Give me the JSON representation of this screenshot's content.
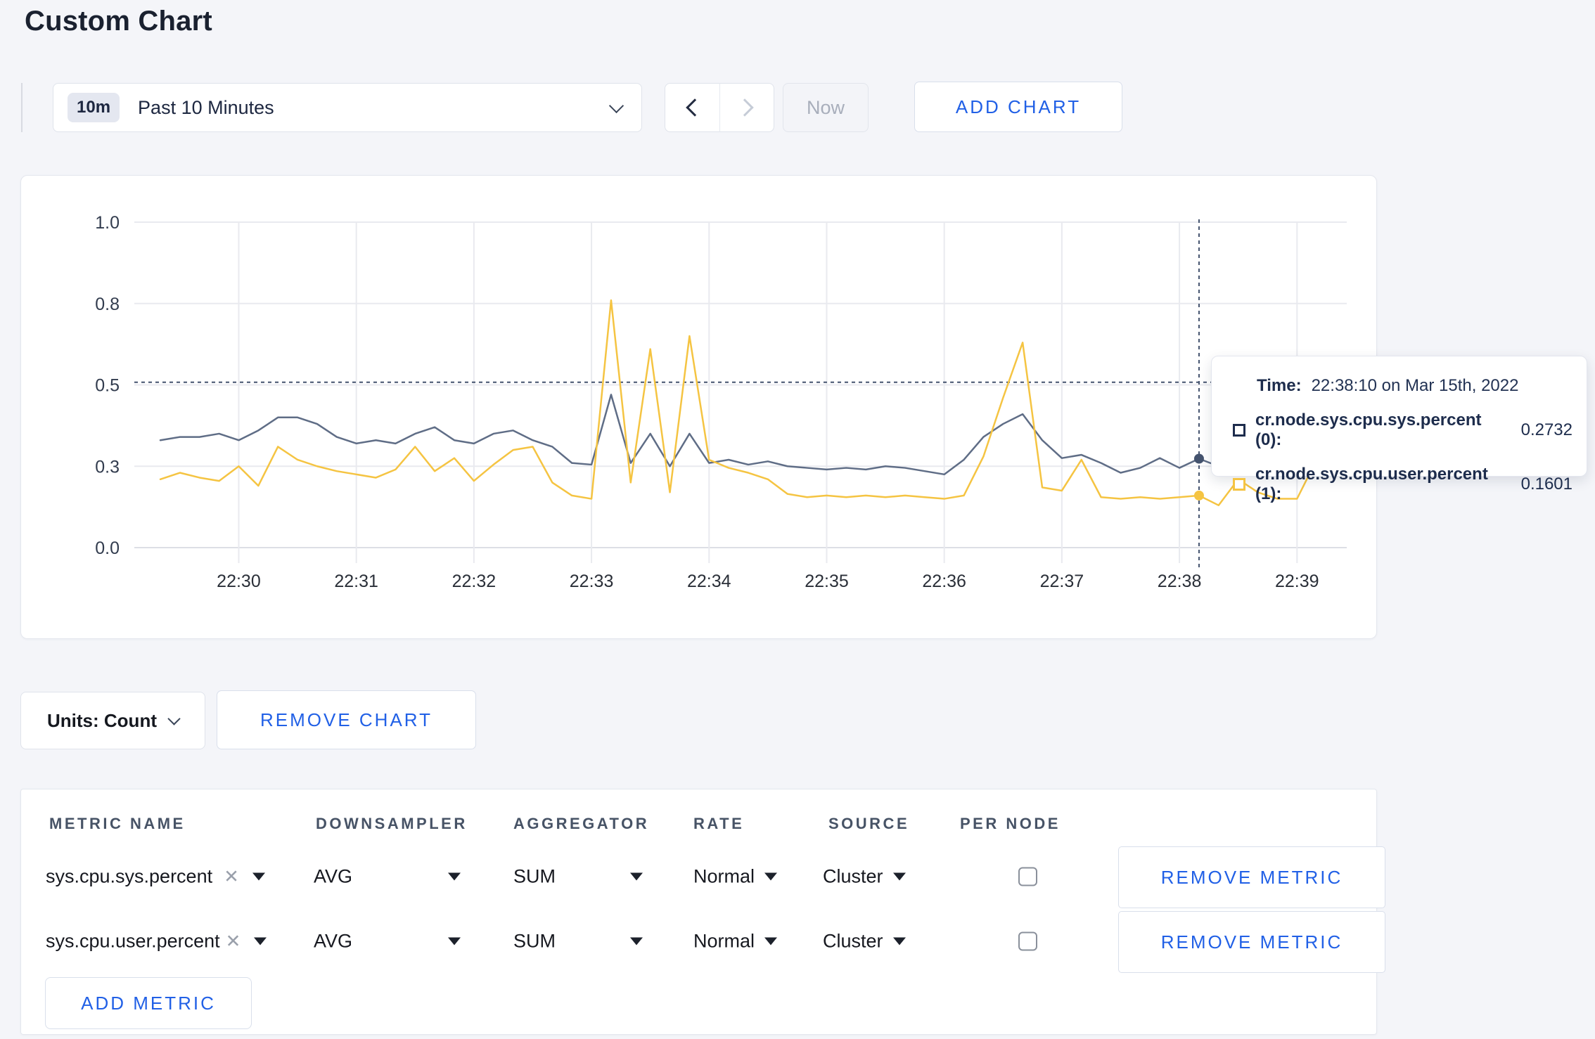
{
  "page": {
    "title": "Custom Chart",
    "background": "#f4f5f9"
  },
  "toolbar": {
    "time_window_badge": "10m",
    "time_window_label": "Past 10 Minutes",
    "now_label": "Now",
    "add_chart_label": "ADD CHART"
  },
  "chart_data": {
    "type": "line",
    "title": "",
    "xlabel": "",
    "ylabel": "",
    "ylim": [
      0,
      1.0
    ],
    "grid": true,
    "legend_position": "none",
    "y_ticks": [
      {
        "value": 0,
        "label": "0.0"
      },
      {
        "value": 0.25,
        "label": "0.3"
      },
      {
        "value": 0.5,
        "label": "0.5"
      },
      {
        "value": 0.75,
        "label": "0.8"
      },
      {
        "value": 1.0,
        "label": "1.0"
      }
    ],
    "x_tick_labels": [
      "22:30",
      "22:31",
      "22:32",
      "22:33",
      "22:34",
      "22:35",
      "22:36",
      "22:37",
      "22:38",
      "22:39"
    ],
    "x": [
      "22:29:20",
      "22:29:30",
      "22:29:40",
      "22:29:50",
      "22:30:00",
      "22:30:10",
      "22:30:20",
      "22:30:30",
      "22:30:40",
      "22:30:50",
      "22:31:00",
      "22:31:10",
      "22:31:20",
      "22:31:30",
      "22:31:40",
      "22:31:50",
      "22:32:00",
      "22:32:10",
      "22:32:20",
      "22:32:30",
      "22:32:40",
      "22:32:50",
      "22:33:00",
      "22:33:10",
      "22:33:20",
      "22:33:30",
      "22:33:40",
      "22:33:50",
      "22:34:00",
      "22:34:10",
      "22:34:20",
      "22:34:30",
      "22:34:40",
      "22:34:50",
      "22:35:00",
      "22:35:10",
      "22:35:20",
      "22:35:30",
      "22:35:40",
      "22:35:50",
      "22:36:00",
      "22:36:10",
      "22:36:20",
      "22:36:30",
      "22:36:40",
      "22:36:50",
      "22:37:00",
      "22:37:10",
      "22:37:20",
      "22:37:30",
      "22:37:40",
      "22:37:50",
      "22:38:00",
      "22:38:10",
      "22:38:20",
      "22:38:30",
      "22:38:40",
      "22:38:50",
      "22:39:00",
      "22:39:10"
    ],
    "series": [
      {
        "name": "cr.node.sys.cpu.sys.percent (0)",
        "color": "#5f6d86",
        "values": [
          0.33,
          0.34,
          0.34,
          0.35,
          0.33,
          0.36,
          0.4,
          0.4,
          0.38,
          0.34,
          0.32,
          0.33,
          0.32,
          0.35,
          0.37,
          0.33,
          0.32,
          0.35,
          0.36,
          0.33,
          0.31,
          0.26,
          0.255,
          0.47,
          0.26,
          0.35,
          0.25,
          0.35,
          0.26,
          0.27,
          0.255,
          0.265,
          0.25,
          0.245,
          0.24,
          0.245,
          0.24,
          0.25,
          0.245,
          0.235,
          0.225,
          0.27,
          0.34,
          0.38,
          0.41,
          0.33,
          0.275,
          0.285,
          0.26,
          0.23,
          0.245,
          0.275,
          0.245,
          0.2732,
          0.25,
          0.24,
          0.27,
          0.275,
          0.28,
          0.3
        ]
      },
      {
        "name": "cr.node.sys.cpu.user.percent (1)",
        "color": "#f5c442",
        "values": [
          0.21,
          0.23,
          0.215,
          0.205,
          0.25,
          0.19,
          0.31,
          0.27,
          0.25,
          0.235,
          0.225,
          0.215,
          0.24,
          0.31,
          0.235,
          0.275,
          0.205,
          0.255,
          0.3,
          0.31,
          0.2,
          0.16,
          0.15,
          0.76,
          0.2,
          0.61,
          0.17,
          0.65,
          0.27,
          0.245,
          0.23,
          0.21,
          0.165,
          0.155,
          0.16,
          0.155,
          0.16,
          0.155,
          0.16,
          0.155,
          0.15,
          0.16,
          0.28,
          0.46,
          0.63,
          0.185,
          0.175,
          0.27,
          0.155,
          0.15,
          0.155,
          0.15,
          0.155,
          0.1601,
          0.13,
          0.21,
          0.17,
          0.15,
          0.15,
          0.27
        ]
      }
    ],
    "crosshair": {
      "index": 53,
      "time": "22:38:10",
      "h_line_value": 0.508
    }
  },
  "tooltip": {
    "time_label": "Time:",
    "time_value": "22:38:10 on Mar 15th, 2022",
    "rows": [
      {
        "label": "cr.node.sys.cpu.sys.percent (0):",
        "value": "0.2732",
        "swatch_color": "#1d2c4c"
      },
      {
        "label": "cr.node.sys.cpu.user.percent (1):",
        "value": "0.1601",
        "swatch_color": "#f5c442"
      }
    ]
  },
  "chart_controls": {
    "units_label": "Units: Count",
    "remove_chart_label": "REMOVE CHART"
  },
  "metrics_table": {
    "headers": {
      "metric_name": "METRIC NAME",
      "downsampler": "DOWNSAMPLER",
      "aggregator": "AGGREGATOR",
      "rate": "RATE",
      "source": "SOURCE",
      "per_node": "PER NODE"
    },
    "rows": [
      {
        "metric_name": "sys.cpu.sys.percent",
        "clear_icon": "✕",
        "downsampler": "AVG",
        "aggregator": "SUM",
        "rate": "Normal",
        "source": "Cluster",
        "per_node_checked": false,
        "remove_label": "REMOVE METRIC"
      },
      {
        "metric_name": "sys.cpu.user.percent",
        "clear_icon": "✕",
        "downsampler": "AVG",
        "aggregator": "SUM",
        "rate": "Normal",
        "source": "Cluster",
        "per_node_checked": false,
        "remove_label": "REMOVE METRIC"
      }
    ],
    "add_metric_label": "ADD METRIC"
  },
  "colors": {
    "accent_blue": "#2160e6",
    "navy": "#1d2c4c",
    "series_sys": "#5f6d86",
    "series_user": "#f5c442",
    "grid": "#e9eaef",
    "page_bg": "#f4f5f9"
  }
}
